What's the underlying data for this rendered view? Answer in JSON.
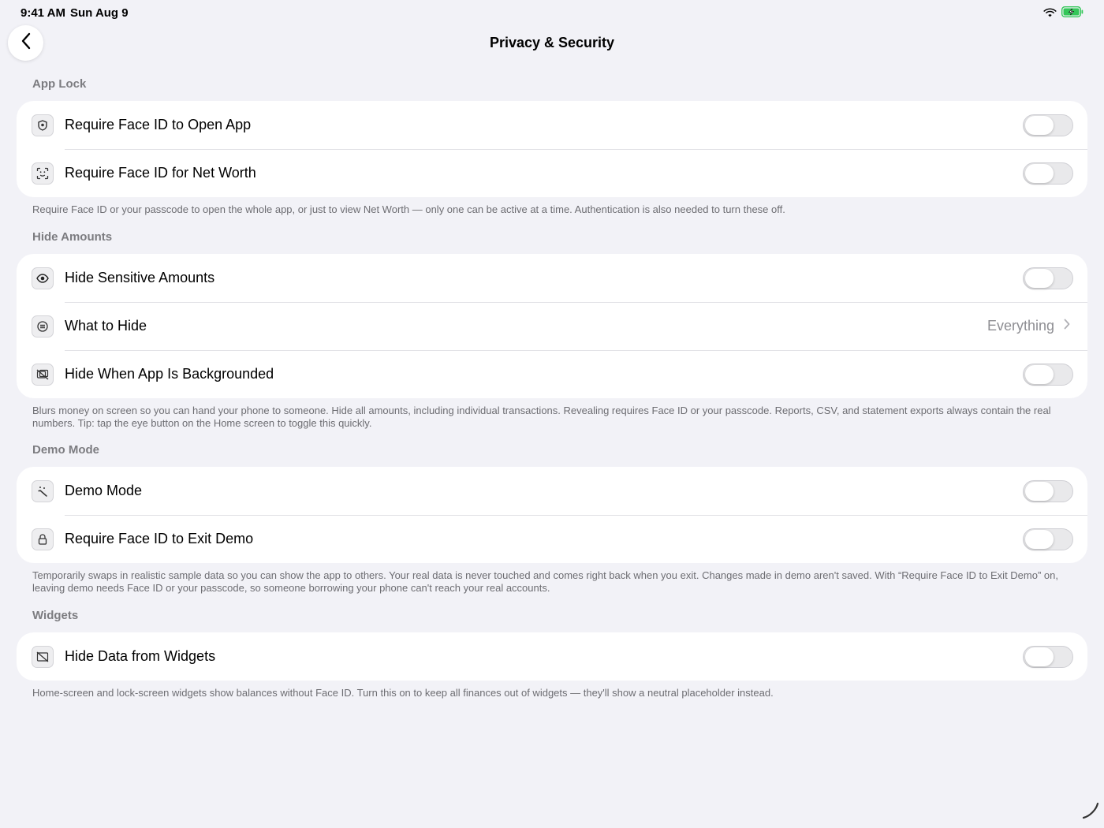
{
  "status": {
    "time": "9:41 AM",
    "date": "Sun Aug 9"
  },
  "header": {
    "title": "Privacy & Security"
  },
  "sections": {
    "app_lock": {
      "title": "App Lock",
      "rows": [
        {
          "label": "Require Face ID to Open App",
          "icon": "shield-icon",
          "toggle": false
        },
        {
          "label": "Require Face ID for Net Worth",
          "icon": "faceid-icon",
          "toggle": false
        }
      ],
      "footer": "Require Face ID or your passcode to open the whole app, or just to view Net Worth — only one can be active at a time. Authentication is also needed to turn these off."
    },
    "hide_amounts": {
      "title": "Hide Amounts",
      "rows": [
        {
          "label": "Hide Sensitive Amounts",
          "icon": "eye-icon",
          "toggle": false
        },
        {
          "label": "What to Hide",
          "icon": "list-icon",
          "value": "Everything"
        },
        {
          "label": "Hide When App Is Backgrounded",
          "icon": "hidden-screen-icon",
          "toggle": false
        }
      ],
      "footer": "Blurs money on screen so you can hand your phone to someone. Hide all amounts, including individual transactions. Revealing requires Face ID or your passcode. Reports, CSV, and statement exports always contain the real numbers. Tip: tap the eye button on the Home screen to toggle this quickly."
    },
    "demo_mode": {
      "title": "Demo Mode",
      "rows": [
        {
          "label": "Demo Mode",
          "icon": "magic-wand-icon",
          "toggle": false
        },
        {
          "label": "Require Face ID to Exit Demo",
          "icon": "lock-icon",
          "toggle": false
        }
      ],
      "footer": "Temporarily swaps in realistic sample data so you can show the app to others. Your real data is never touched and comes right back when you exit. Changes made in demo aren't saved. With “Require Face ID to Exit Demo” on, leaving demo needs Face ID or your passcode, so someone borrowing your phone can't reach your real accounts."
    },
    "widgets": {
      "title": "Widgets",
      "rows": [
        {
          "label": "Hide Data from Widgets",
          "icon": "widget-off-icon",
          "toggle": false
        }
      ],
      "footer": "Home-screen and lock-screen widgets show balances without Face ID. Turn this on to keep all finances out of widgets — they'll show a neutral placeholder instead."
    }
  }
}
